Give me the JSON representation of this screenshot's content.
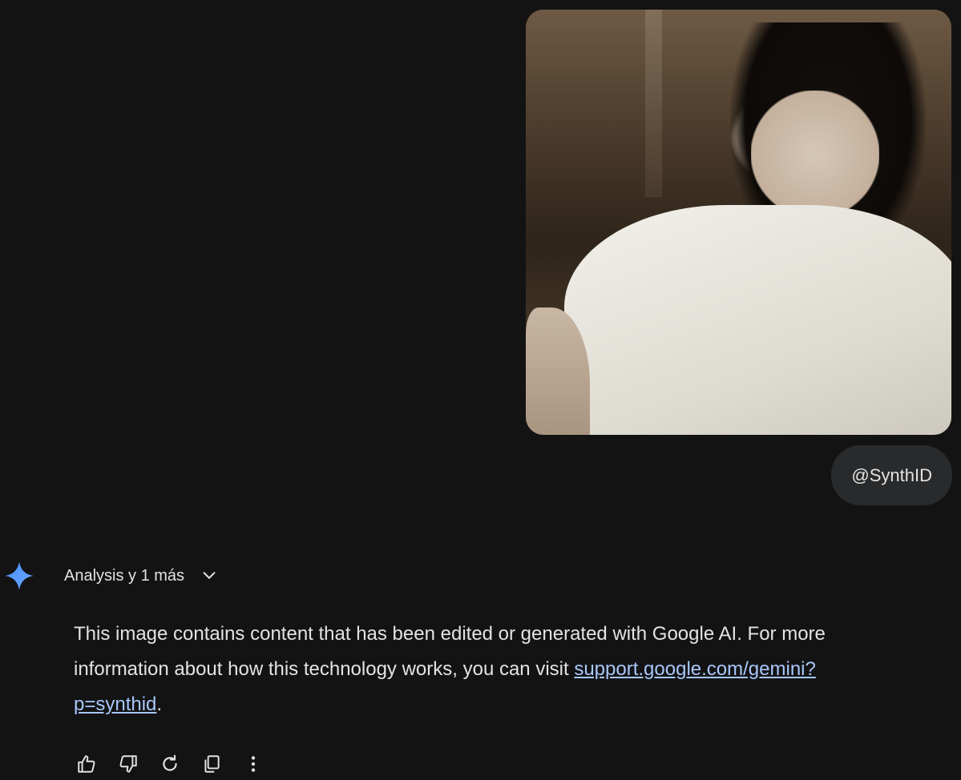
{
  "user_message": {
    "image_alt": "uploaded photo",
    "text": "@SynthID"
  },
  "response": {
    "tools_label": "Analysis y 1 más",
    "text_before_link": "This image contains content that has been edited or generated with Google AI. For more information about how this technology works, you can visit ",
    "link_text": "support.google.com/gemini?p=synthid",
    "text_after_link": "."
  },
  "actions": {
    "icons": [
      "thumbs-up-icon",
      "thumbs-down-icon",
      "regenerate-icon",
      "copy-icon",
      "more-options-icon"
    ]
  },
  "colors": {
    "background": "#131314",
    "chip": "#282a2c",
    "text": "#e3e3e3",
    "link": "#a8c7fa",
    "sparkle_start": "#4b90ff",
    "sparkle_end": "#6aa8ff"
  }
}
